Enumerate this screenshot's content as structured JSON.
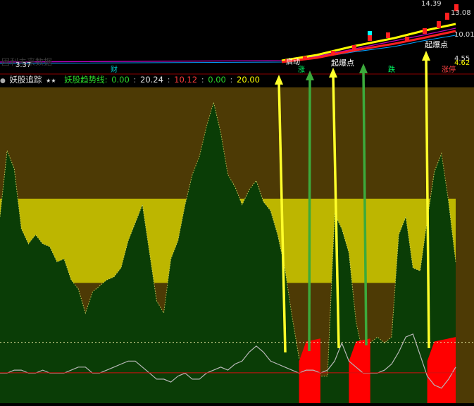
{
  "header": {
    "faded_title": "固利未来数据",
    "low_price": "3.37",
    "marker_cai": "财",
    "high_price": "14.39",
    "price_2": "13.08",
    "price_3": "10.01",
    "price_4": "4.55",
    "price_5": "4.62",
    "up_label": "涨",
    "die_label": "跌",
    "zhang_label": "涨停",
    "buy_point_label": "起爆点",
    "buy_label_2": "起爆点",
    "start_label": "启动"
  },
  "indicator": {
    "name": "妖股追踪",
    "stars": "★★",
    "line_label": "妖股趋势线:",
    "v1": "0.00",
    "v2": "20.24",
    "v3": "10.12",
    "v4": "0.00",
    "v5": "20.00"
  },
  "colors": {
    "background": "#000000",
    "panel": "#4d3a05",
    "band": "#bdb600",
    "mountain": "#0a3d06",
    "signal_fill": "#ff0000",
    "yellow_arrow": "#ffff2a",
    "green_arrow": "#3caa3c"
  },
  "chart_data": {
    "type": "area",
    "x": [
      0,
      1,
      2,
      3,
      4,
      5,
      6,
      7,
      8,
      9,
      10,
      11,
      12,
      13,
      14,
      15,
      16,
      17,
      18,
      19,
      20,
      21,
      22,
      23,
      24,
      25,
      26,
      27,
      28,
      29,
      30,
      31,
      32,
      33,
      34,
      35,
      36,
      37,
      38,
      39,
      40,
      41,
      42,
      43,
      44,
      45,
      46,
      47,
      48,
      49,
      50,
      51,
      52,
      53,
      54,
      55,
      56,
      57,
      58,
      59,
      60,
      61,
      62,
      63,
      64
    ],
    "series": [
      {
        "values": [
          62,
          84,
          78,
          58,
          53,
          56,
          53,
          52,
          47,
          48,
          41,
          38,
          30,
          37,
          39,
          41,
          42,
          45,
          54,
          60,
          66,
          50,
          34,
          30,
          48,
          54,
          66,
          76,
          82,
          92,
          100,
          90,
          76,
          72,
          66,
          71,
          74,
          67,
          64,
          56,
          45,
          29,
          15,
          13,
          11,
          9,
          9,
          63,
          58,
          50,
          27,
          16,
          20,
          22,
          20,
          22,
          56,
          62,
          45,
          44,
          61,
          77,
          83,
          67,
          47
        ],
        "fill": "mountain"
      },
      {
        "values": [
          10,
          10,
          11,
          11,
          10,
          10,
          11,
          10,
          10,
          10,
          11,
          12,
          12,
          10,
          10,
          11,
          12,
          13,
          14,
          14,
          12,
          10,
          8,
          8,
          7,
          9,
          10,
          8,
          8,
          10,
          11,
          12,
          11,
          13,
          14,
          17,
          19,
          17,
          14,
          13,
          12,
          11,
          10,
          11,
          11,
          10,
          11,
          14,
          20,
          14,
          12,
          10,
          10,
          10,
          11,
          13,
          17,
          22,
          23,
          16,
          9,
          6,
          5,
          8,
          12
        ],
        "line": "grey"
      },
      {
        "values": [
          0,
          0,
          0,
          0,
          0,
          0,
          0,
          0,
          0,
          0,
          0,
          0,
          0,
          0,
          0,
          0,
          0,
          0,
          0,
          0,
          0,
          0,
          0,
          0,
          0,
          0,
          0,
          0,
          0,
          0,
          0,
          0,
          0,
          0,
          0,
          0,
          0,
          0,
          0,
          0,
          0,
          0,
          0,
          0,
          0,
          0,
          0,
          0,
          0,
          0,
          0,
          0,
          0,
          0,
          0,
          0,
          0,
          0,
          0,
          0,
          0,
          0,
          0,
          0,
          0
        ],
        "note": "signal"
      }
    ],
    "signals": [
      {
        "start": 42,
        "end": 45,
        "level": 20
      },
      {
        "start": 49,
        "end": 52,
        "level": 20
      },
      {
        "start": 60,
        "end": 64,
        "level": 20
      }
    ],
    "band": {
      "low": 40,
      "high": 68
    },
    "ref_levels": [
      10.12,
      20.24
    ],
    "ylim": [
      0,
      105
    ]
  }
}
